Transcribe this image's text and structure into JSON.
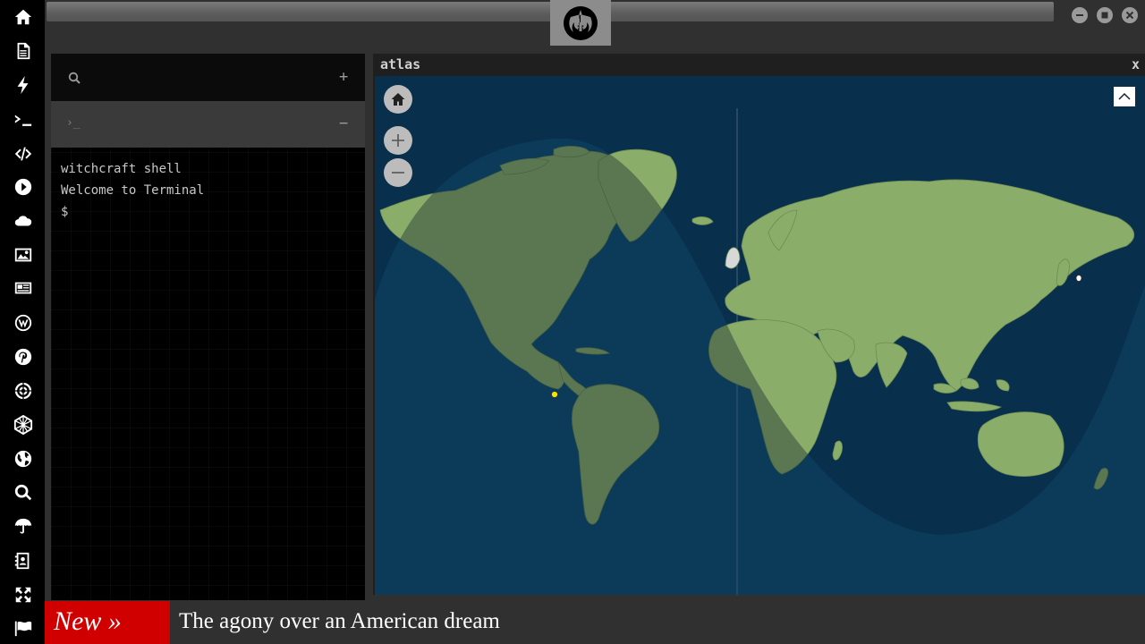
{
  "sidebar": {
    "icons": [
      "home-icon",
      "document-icon",
      "bolt-icon",
      "terminal-icon",
      "code-icon",
      "play-icon",
      "cloud-icon",
      "image-icon",
      "newspaper-icon",
      "wordpress-icon",
      "pinterest-icon",
      "empire-icon",
      "web-icon",
      "globe-icon",
      "search-icon",
      "umbrella-icon",
      "contact-book-icon",
      "expand-icon",
      "flag-icon"
    ]
  },
  "header": {
    "emblem": "rebel-alliance-icon",
    "window_controls": [
      "minimize-icon",
      "maximize-icon",
      "close-icon"
    ]
  },
  "terminal": {
    "search_icon": "search-icon",
    "add_label": "+",
    "tab_prompt": "›_",
    "tab_minus": "−",
    "lines": [
      "witchcraft shell",
      "Welcome to Terminal",
      "$"
    ]
  },
  "atlas": {
    "title": "atlas",
    "close_label": "x",
    "controls": [
      "home-icon",
      "zoom-in-icon",
      "zoom-out-icon"
    ],
    "collapse_icon": "chevron-up-icon",
    "colors": {
      "ocean": "#0e4568",
      "land": "#8bad6a",
      "night": "#06263d",
      "marker_primary": "#f2e600",
      "marker_secondary": "#ffffff"
    }
  },
  "ticker": {
    "badge": "New »",
    "headline": "The agony over an American dream"
  }
}
